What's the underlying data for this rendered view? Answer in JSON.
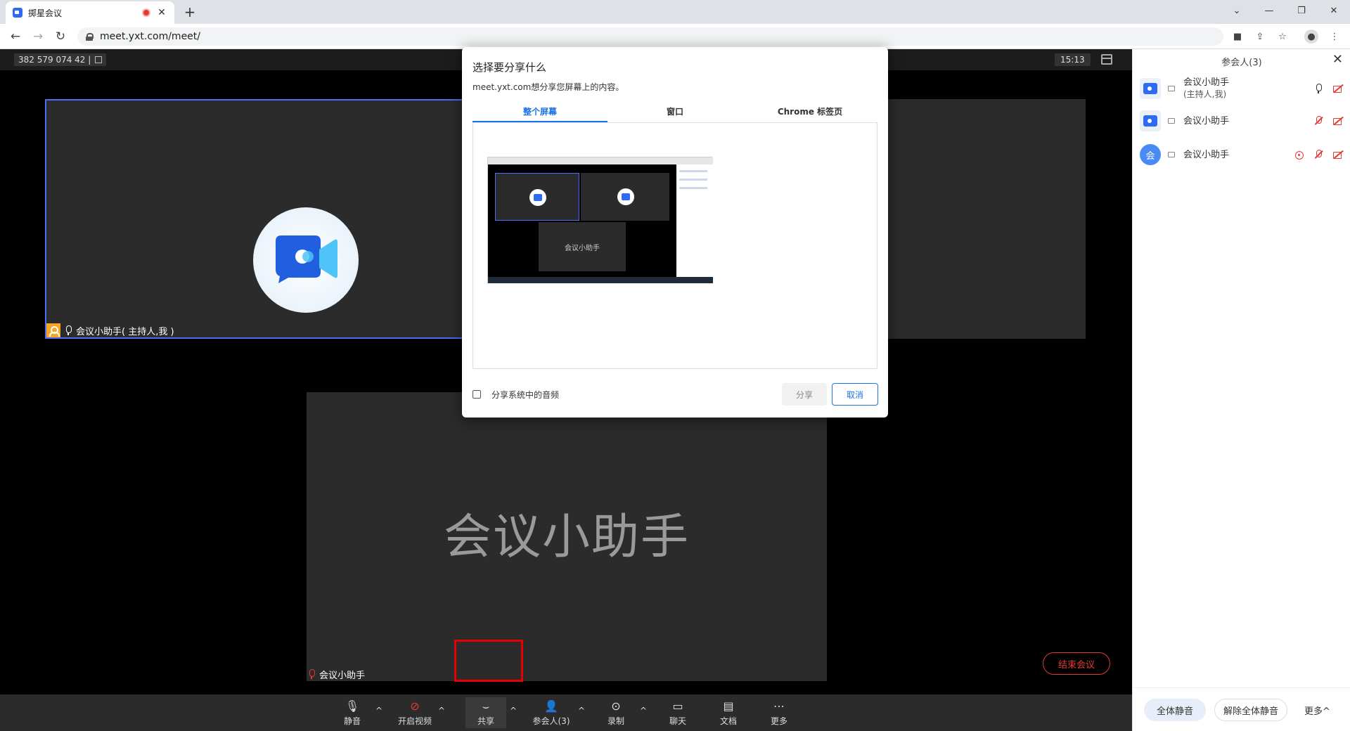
{
  "browser": {
    "tab_title": "掷星会议",
    "url": "meet.yxt.com/meet/"
  },
  "meeting": {
    "meeting_id": "382 579 074 42 |",
    "clock": "15:13",
    "tiles": [
      {
        "label": "会议小助手( 主持人,我 )"
      },
      {
        "label": "会议小助手",
        "big_name": "会议小助手"
      }
    ]
  },
  "toolbar": {
    "mute": "静音",
    "video": "开启视频",
    "share": "共享",
    "participants": "参会人(3)",
    "record": "录制",
    "chat": "聊天",
    "docs": "文档",
    "more": "更多",
    "end": "结束会议"
  },
  "panel": {
    "title": "参会人(3)",
    "participants": [
      {
        "name": "会议小助手",
        "sub": "(主持人,我)",
        "avatar": ""
      },
      {
        "name": "会议小助手",
        "sub": "",
        "avatar": ""
      },
      {
        "name": "会议小助手",
        "sub": "",
        "avatar": "会"
      }
    ],
    "mute_all": "全体静音",
    "unmute_all": "解除全体静音",
    "more": "更多^"
  },
  "dialog": {
    "title": "选择要分享什么",
    "subtitle": "meet.yxt.com想分享您屏幕上的内容。",
    "tabs": [
      "整个屏幕",
      "窗口",
      "Chrome 标签页"
    ],
    "thumb_label": "会议小助手",
    "audio_label": "分享系统中的音频",
    "share_button": "分享",
    "cancel_button": "取消"
  },
  "colors": {
    "accent": "#1a73e8",
    "danger": "#e53935",
    "brand": "#2f6bf2",
    "highlight": "#e60000"
  }
}
